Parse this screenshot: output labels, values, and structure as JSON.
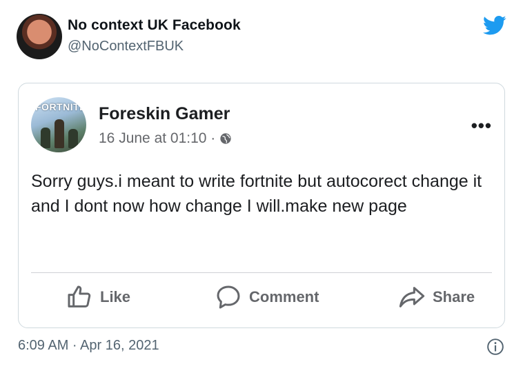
{
  "tweet": {
    "display_name": "No context UK Facebook",
    "handle": "@NoContextFBUK",
    "timestamp": "6:09 AM · Apr 16, 2021",
    "icons": {
      "brand": "twitter-bird-icon",
      "info": "info-icon"
    },
    "colors": {
      "twitter_blue": "#1d9bf0",
      "secondary_text": "#536471",
      "border": "#cfd9de"
    }
  },
  "fb_post": {
    "author": "Foreskin Gamer",
    "date": "16 June at 01:10 ·",
    "avatar_text": "FORTNITE",
    "text": "Sorry guys.i meant to write fortnite but autocorect change it and I dont now how change I will.make new page",
    "more": "•••",
    "actions": {
      "like": "Like",
      "comment": "Comment",
      "share": "Share"
    },
    "icons": {
      "privacy": "globe-icon",
      "like": "thumbs-up-icon",
      "comment": "speech-bubble-icon",
      "share": "share-arrow-icon"
    }
  }
}
